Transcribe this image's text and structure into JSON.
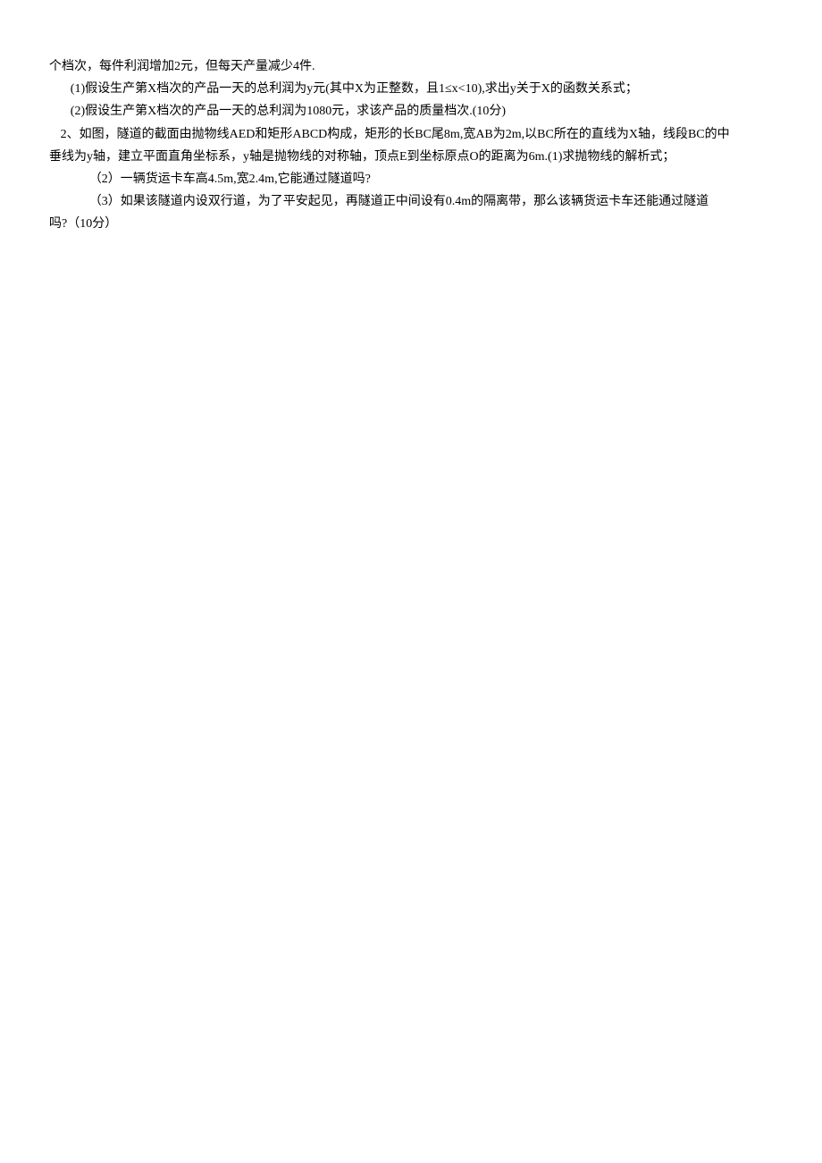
{
  "doc": {
    "l1": "个档次，每件利润增加2元，但每天产量减少4件.",
    "l2": "(1)假设生产第X档次的产品一天的总利润为y元(其中X为正整数，且1≤x<10),求出y关于X的函数关系式；",
    "l3": "(2)假设生产第X档次的产品一天的总利润为1080元，求该产品的质量档次.(10分)",
    "l4": "2、如图，隧道的截面由抛物线AED和矩形ABCD构成，矩形的长BC尾8m,宽AB为2m,以BC所在的直线为X轴，线段BC的中",
    "l5": "垂线为y轴，建立平面直角坐标系，y轴是抛物线的对称轴，顶点E到坐标原点O的距离为6m.(1)求抛物线的解析式；",
    "l6": "（2）一辆货运卡车高4.5m,宽2.4m,它能通过隧道吗?",
    "l7": "（3）如果该隧道内设双行道，为了平安起见，再隧道正中间设有0.4m的隔离带，那么该辆货运卡车还能通过隧道",
    "l8": "吗?（10分）"
  }
}
